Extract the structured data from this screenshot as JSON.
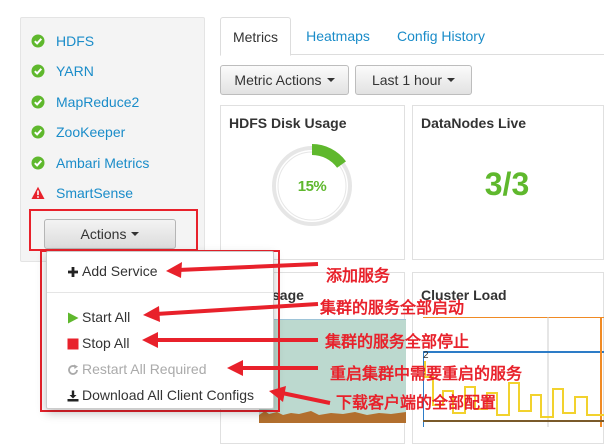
{
  "sidebar": {
    "services": [
      {
        "label": "HDFS",
        "status": "ok"
      },
      {
        "label": "YARN",
        "status": "ok"
      },
      {
        "label": "MapReduce2",
        "status": "ok"
      },
      {
        "label": "ZooKeeper",
        "status": "ok"
      },
      {
        "label": "Ambari Metrics",
        "status": "ok"
      },
      {
        "label": "SmartSense",
        "status": "alert"
      }
    ],
    "actions_label": "Actions"
  },
  "tabs": [
    {
      "label": "Metrics",
      "active": true
    },
    {
      "label": "Heatmaps",
      "active": false
    },
    {
      "label": "Config History",
      "active": false
    }
  ],
  "toolbar": {
    "metric_actions_label": "Metric Actions",
    "time_range_label": "Last 1 hour"
  },
  "widgets": {
    "hdfs_disk_usage": {
      "title": "HDFS Disk Usage",
      "percent_label": "15%",
      "percent": 15
    },
    "datanodes_live": {
      "title": "DataNodes Live",
      "value": "3/3"
    },
    "cluster_load": {
      "title": "Cluster Load",
      "axis_tick": "2"
    },
    "partial_left_title": "sage"
  },
  "dropdown": {
    "items": [
      {
        "label": "Add Service",
        "icon": "plus-icon",
        "disabled": false
      },
      {
        "label": "Start All",
        "icon": "play-icon",
        "disabled": false
      },
      {
        "label": "Stop All",
        "icon": "stop-icon",
        "disabled": false
      },
      {
        "label": "Restart All Required",
        "icon": "refresh-icon",
        "disabled": true
      },
      {
        "label": "Download All Client Configs",
        "icon": "download-icon",
        "disabled": false
      }
    ]
  },
  "annotations": [
    "添加服务",
    "集群的服务全部启动",
    "集群的服务全部停止",
    "重启集群中需要重启的服务",
    "下载客户端的全部配置"
  ],
  "colors": {
    "ok_green": "#5fb82d",
    "alert_red": "#e8212b",
    "link_blue": "#1a8cc9",
    "load_orange": "#f08a24",
    "load_blue": "#2d7cc7",
    "load_yellow": "#f2d22e"
  }
}
